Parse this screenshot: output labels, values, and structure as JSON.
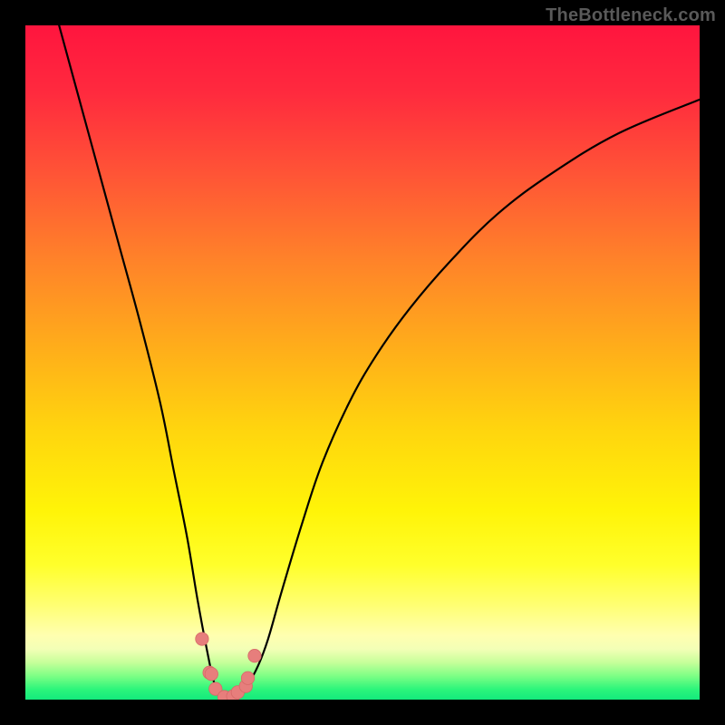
{
  "watermark": {
    "text": "TheBottleneck.com"
  },
  "colors": {
    "frame": "#000000",
    "curve_stroke": "#000000",
    "marker_fill": "#e77e7c",
    "marker_stroke": "#d66a68",
    "gradient_stops": [
      {
        "offset": 0.0,
        "color": "#ff153e"
      },
      {
        "offset": 0.1,
        "color": "#ff2a3e"
      },
      {
        "offset": 0.22,
        "color": "#ff5436"
      },
      {
        "offset": 0.35,
        "color": "#ff8329"
      },
      {
        "offset": 0.48,
        "color": "#ffae1a"
      },
      {
        "offset": 0.6,
        "color": "#ffd50e"
      },
      {
        "offset": 0.72,
        "color": "#fff408"
      },
      {
        "offset": 0.8,
        "color": "#ffff2b"
      },
      {
        "offset": 0.86,
        "color": "#ffff73"
      },
      {
        "offset": 0.905,
        "color": "#ffffb0"
      },
      {
        "offset": 0.925,
        "color": "#f3ffb6"
      },
      {
        "offset": 0.945,
        "color": "#c6ff9a"
      },
      {
        "offset": 0.965,
        "color": "#7dff85"
      },
      {
        "offset": 0.985,
        "color": "#2bf57b"
      },
      {
        "offset": 1.0,
        "color": "#14e97c"
      }
    ]
  },
  "chart_data": {
    "type": "line",
    "title": "",
    "xlabel": "",
    "ylabel": "",
    "xlim": [
      0,
      100
    ],
    "ylim": [
      0,
      100
    ],
    "series": [
      {
        "name": "bottleneck-curve",
        "x": [
          5,
          8,
          11,
          14,
          17,
          20,
          22,
          24,
          25.5,
          27,
          28,
          29,
          30,
          31.5,
          33,
          34.5,
          36,
          38,
          41,
          44,
          48,
          52,
          57,
          63,
          70,
          78,
          88,
          100
        ],
        "y": [
          100,
          89,
          78,
          67,
          56,
          44,
          34,
          24,
          15,
          7,
          2.5,
          0.6,
          0.2,
          0.7,
          2.3,
          5,
          9,
          16,
          26,
          35,
          44,
          51,
          58,
          65,
          72,
          78,
          84,
          89
        ]
      }
    ],
    "markers": {
      "name": "highlight-points",
      "points": [
        {
          "x": 26.2,
          "y": 9.0
        },
        {
          "x": 27.3,
          "y": 4.0
        },
        {
          "x": 27.6,
          "y": 3.8
        },
        {
          "x": 28.2,
          "y": 1.6
        },
        {
          "x": 29.5,
          "y": 0.4
        },
        {
          "x": 30.8,
          "y": 0.5
        },
        {
          "x": 31.5,
          "y": 1.1
        },
        {
          "x": 32.7,
          "y": 2.0
        },
        {
          "x": 33.0,
          "y": 3.2
        },
        {
          "x": 34.0,
          "y": 6.5
        }
      ]
    }
  }
}
